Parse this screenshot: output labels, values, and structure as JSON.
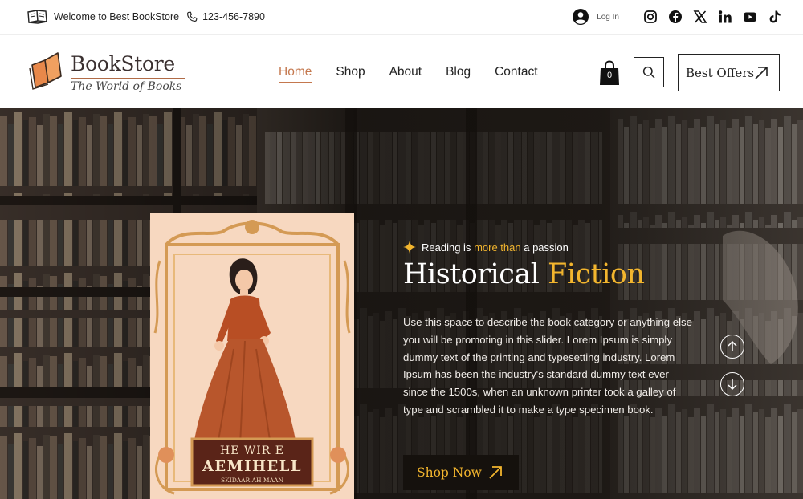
{
  "topbar": {
    "welcome_text": "Welcome to Best BookStore",
    "phone": "123-456-7890",
    "login_label": "Log In",
    "social": [
      "instagram-icon",
      "facebook-icon",
      "x-icon",
      "linkedin-icon",
      "youtube-icon",
      "tiktok-icon"
    ]
  },
  "header": {
    "logo_title": "BookStore",
    "logo_subtitle": "The World of Books",
    "nav": [
      {
        "label": "Home",
        "active": true
      },
      {
        "label": "Shop",
        "active": false
      },
      {
        "label": "About",
        "active": false
      },
      {
        "label": "Blog",
        "active": false
      },
      {
        "label": "Contact",
        "active": false
      }
    ],
    "cart_count": "0",
    "offers_label": "Best Offers"
  },
  "hero": {
    "tagline_prefix": "Reading is",
    "tagline_highlight": "more than",
    "tagline_suffix": "a passion",
    "title_main": "Historical",
    "title_highlight": "Fiction",
    "description": "Use this space to describe the book category or anything else you will be promoting in this slider. Lorem Ipsum is simply dummy text of the printing and typesetting industry. Lorem Ipsum has been the industry's standard dummy text ever since the 1500s, when an unknown printer took a galley of type and scrambled it to make  a type specimen book.",
    "cta_label": "Shop Now",
    "book_cover": {
      "line1": "HE WIR E",
      "line2": "AEMIHELL",
      "line3": "SKIDAAR AH MAAN"
    }
  },
  "colors": {
    "accent_gold": "#f2b52e",
    "accent_copper": "#c4784e",
    "dark": "#15110d"
  }
}
